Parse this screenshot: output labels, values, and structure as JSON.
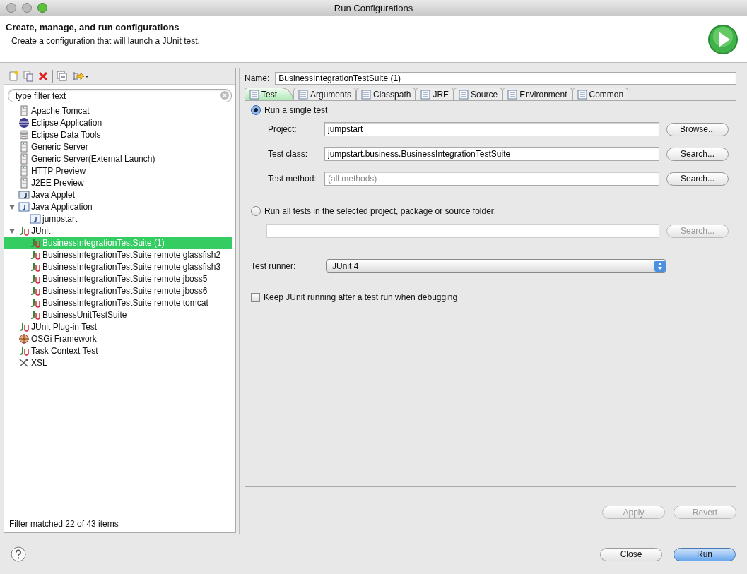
{
  "window": {
    "title": "Run Configurations"
  },
  "header": {
    "title": "Create, manage, and run configurations",
    "subtitle": "Create a configuration that will launch a JUnit test."
  },
  "filter": {
    "placeholder": "type filter text"
  },
  "tree": [
    {
      "label": "Apache Tomcat",
      "kind": "server",
      "selected": false
    },
    {
      "label": "Eclipse Application",
      "kind": "eclipse",
      "selected": false
    },
    {
      "label": "Eclipse Data Tools",
      "kind": "database",
      "selected": false
    },
    {
      "label": "Generic Server",
      "kind": "server",
      "selected": false
    },
    {
      "label": "Generic Server(External Launch)",
      "kind": "server",
      "selected": false
    },
    {
      "label": "HTTP Preview",
      "kind": "server",
      "selected": false
    },
    {
      "label": "J2EE Preview",
      "kind": "server",
      "selected": false
    },
    {
      "label": "Java Applet",
      "kind": "applet",
      "selected": false
    },
    {
      "label": "Java Application",
      "kind": "java",
      "selected": false,
      "expanded": true,
      "children": [
        {
          "label": "jumpstart",
          "kind": "java",
          "selected": false
        }
      ]
    },
    {
      "label": "JUnit",
      "kind": "junit",
      "selected": false,
      "expanded": true,
      "children": [
        {
          "label": "BusinessIntegrationTestSuite (1)",
          "kind": "junit",
          "selected": true
        },
        {
          "label": "BusinessIntegrationTestSuite remote glassfish2",
          "kind": "junit",
          "selected": false
        },
        {
          "label": "BusinessIntegrationTestSuite remote glassfish3",
          "kind": "junit",
          "selected": false
        },
        {
          "label": "BusinessIntegrationTestSuite remote jboss5",
          "kind": "junit",
          "selected": false
        },
        {
          "label": "BusinessIntegrationTestSuite remote jboss6",
          "kind": "junit",
          "selected": false
        },
        {
          "label": "BusinessIntegrationTestSuite remote tomcat",
          "kind": "junit",
          "selected": false
        },
        {
          "label": "BusinessUnitTestSuite",
          "kind": "junit",
          "selected": false
        }
      ]
    },
    {
      "label": "JUnit Plug-in Test",
      "kind": "junit",
      "selected": false
    },
    {
      "label": "OSGi Framework",
      "kind": "osgi",
      "selected": false
    },
    {
      "label": "Task Context Test",
      "kind": "junit",
      "selected": false
    },
    {
      "label": "XSL",
      "kind": "xsl",
      "selected": false
    }
  ],
  "filter_status": "Filter matched 22 of 43 items",
  "name": {
    "label": "Name:",
    "value": "BusinessIntegrationTestSuite (1)"
  },
  "tabs": [
    {
      "label": "Test",
      "selected": true
    },
    {
      "label": "Arguments",
      "selected": false
    },
    {
      "label": "Classpath",
      "selected": false
    },
    {
      "label": "JRE",
      "selected": false
    },
    {
      "label": "Source",
      "selected": false
    },
    {
      "label": "Environment",
      "selected": false
    },
    {
      "label": "Common",
      "selected": false
    }
  ],
  "single_test": {
    "label": "Run a single test",
    "selected": true,
    "fields": [
      {
        "label": "Project:",
        "value": "jumpstart",
        "button": "Browse..."
      },
      {
        "label": "Test class:",
        "value": "jumpstart.business.BusinessIntegrationTestSuite",
        "button": "Search..."
      },
      {
        "label": "Test method:",
        "placeholder": "(all methods)",
        "button": "Search..."
      }
    ]
  },
  "all_tests": {
    "label": "Run all tests in the selected project, package or source folder:",
    "selected": false,
    "button": "Search...",
    "disabled": true
  },
  "test_runner": {
    "label": "Test runner:",
    "value": "JUnit 4"
  },
  "keep_running": {
    "label": "Keep JUnit running after a test run when debugging",
    "checked": false
  },
  "apply": {
    "label": "Apply",
    "disabled": true
  },
  "revert": {
    "label": "Revert",
    "disabled": true
  },
  "close": {
    "label": "Close"
  },
  "run": {
    "label": "Run"
  }
}
